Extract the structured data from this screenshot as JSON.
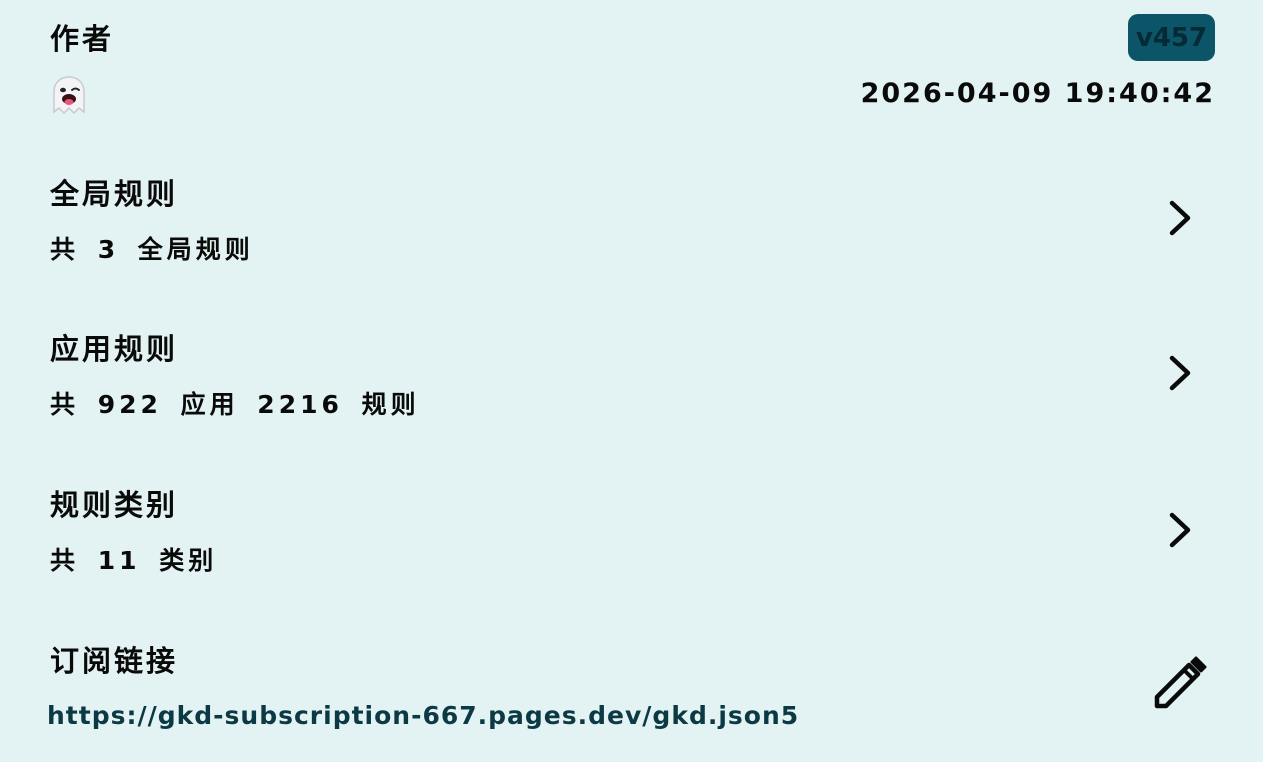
{
  "author": {
    "title": "作者",
    "avatar_icon": "ghost-emoji-icon"
  },
  "version": "v457",
  "updated_at": "2026-04-09 19:40:42",
  "sections": [
    {
      "title": "全局规则",
      "subtitle": "共 3 全局规则",
      "icon": "chevron-right-icon"
    },
    {
      "title": "应用规则",
      "subtitle": "共 922 应用 2216 规则",
      "icon": "chevron-right-icon"
    },
    {
      "title": "规则类别",
      "subtitle": "共 11 类别",
      "icon": "chevron-right-icon"
    }
  ],
  "subscription": {
    "title": "订阅链接",
    "url": "https://gkd-subscription-667.pages.dev/gkd.json5",
    "edit_icon": "pencil-icon"
  },
  "colors": {
    "background": "#e3f2f2",
    "badge_bg": "#0c5468",
    "badge_text": "#042a36",
    "link_text": "#0c3a44"
  }
}
